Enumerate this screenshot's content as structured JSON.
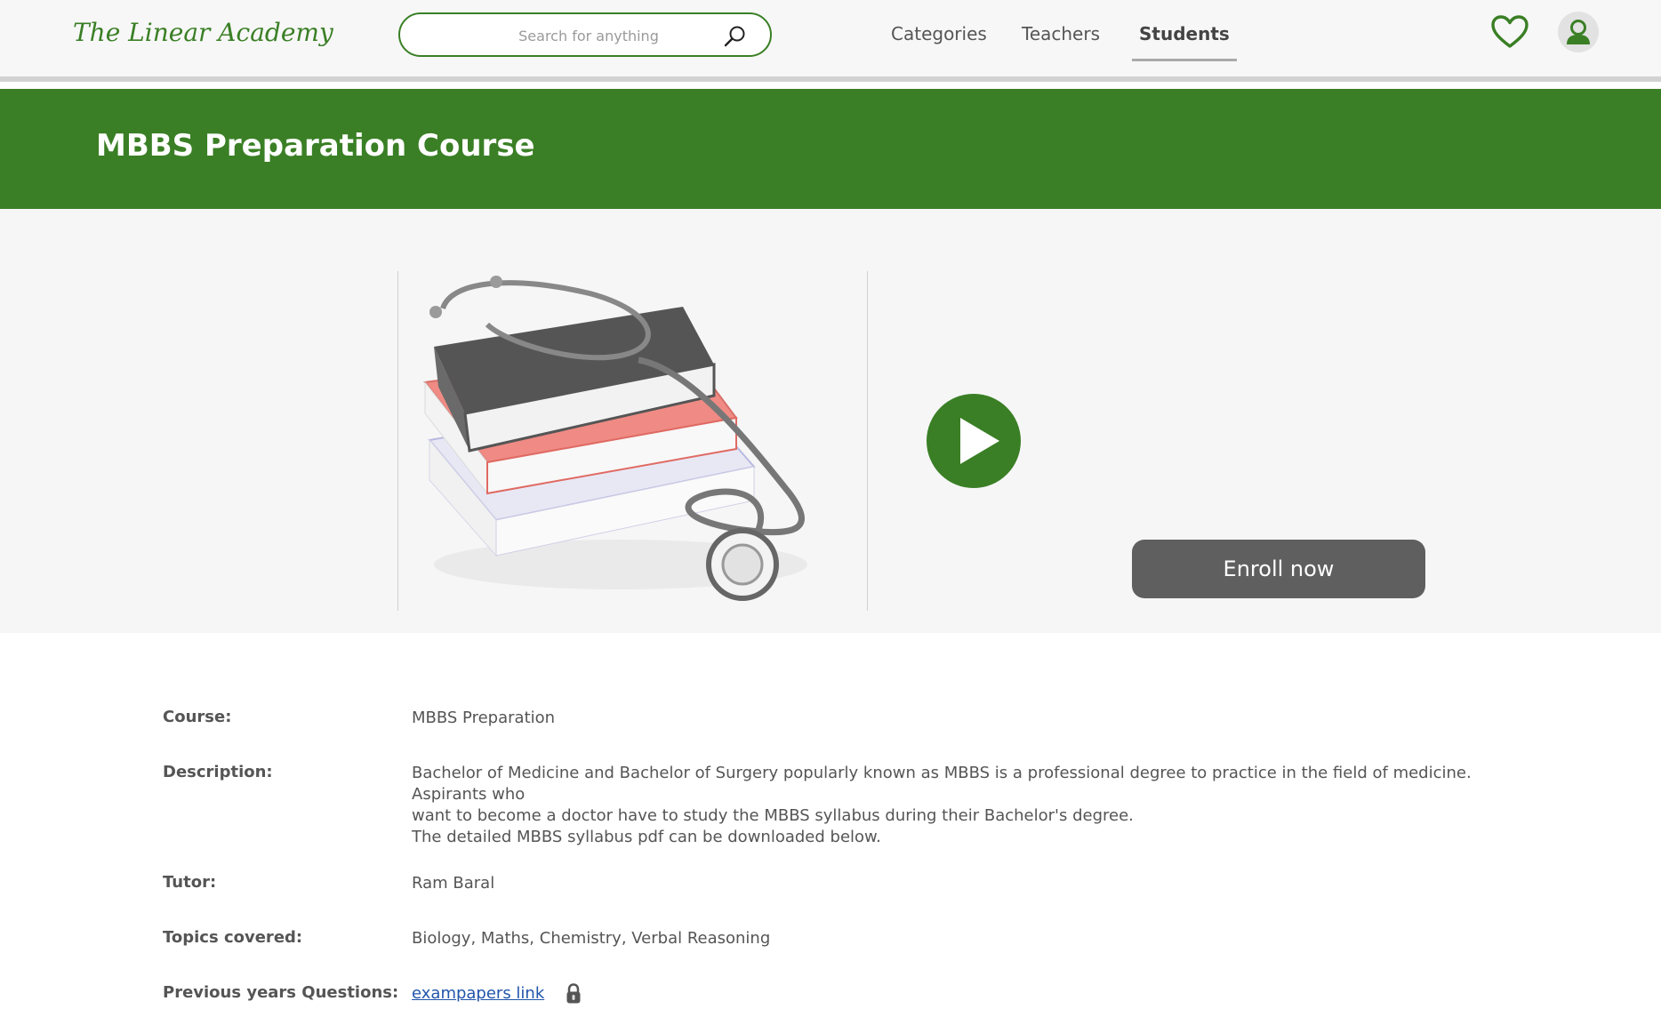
{
  "header": {
    "logo": "The Linear Academy",
    "search_placeholder": "Search for anything",
    "nav": {
      "categories": "Categories",
      "teachers": "Teachers",
      "students": "Students"
    }
  },
  "banner": {
    "title": "MBBS Preparation Course"
  },
  "hero": {
    "enroll_label": "Enroll now"
  },
  "details": {
    "course_label": "Course:",
    "course_value": "MBBS Preparation",
    "description_label": "Description:",
    "description_lines": [
      "Bachelor of Medicine and Bachelor of Surgery popularly known as MBBS is a professional degree to practice in the field of medicine.",
      "Aspirants  who",
      "want to become a doctor have to study the MBBS syllabus during their Bachelor's degree.",
      "The detailed MBBS syllabus pdf can be downloaded below."
    ],
    "tutor_label": "Tutor:",
    "tutor_value": "Ram Baral",
    "topics_label": "Topics covered:",
    "topics_value": "Biology, Maths, Chemistry, Verbal Reasoning",
    "pyq_label": "Previous years Questions:",
    "pyq_link": "exampapers link"
  },
  "colors": {
    "brand_green": "#3a7f25",
    "button_gray": "#5f5f5f",
    "link_blue": "#2255aa"
  },
  "icons": [
    "search-icon",
    "heart-icon",
    "user-icon",
    "play-icon",
    "lock-icon"
  ]
}
